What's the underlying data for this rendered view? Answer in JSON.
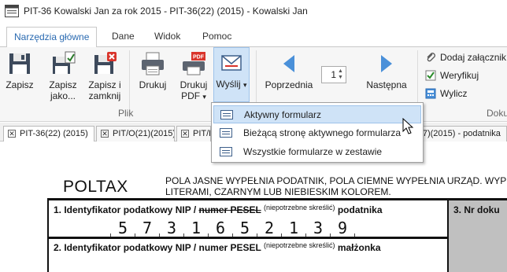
{
  "window": {
    "title": "PIT-36 Kowalski Jan za rok 2015 - PIT-36(22) (2015) - Kowalski Jan"
  },
  "ribbon_tabs": [
    "Narzędzia główne",
    "Dane",
    "Widok",
    "Pomoc"
  ],
  "toolbar": {
    "zapisz": "Zapisz",
    "zapisz_jako_1": "Zapisz",
    "zapisz_jako_2": "jako...",
    "zapisz_zamknij_1": "Zapisz i",
    "zapisz_zamknij_2": "zamknij",
    "drukuj": "Drukuj",
    "drukuj_pdf_1": "Drukuj",
    "drukuj_pdf_2": "PDF",
    "wyslij": "Wyślij",
    "poprzednia": "Poprzednia",
    "nastepna": "Następna",
    "page_value": "1",
    "dodaj_zalacznik": "Dodaj załącznik",
    "weryfikuj": "Weryfikuj",
    "wylicz": "Wylicz",
    "group_plik": "Plik",
    "group_doku": "Doku",
    "pdf_badge": "PDF",
    "dropdown_arrow": "▾"
  },
  "send_menu": {
    "items": [
      "Aktywny formularz",
      "Bieżącą stronę aktywnego formularza",
      "Wszystkie formularze w zestawie"
    ]
  },
  "doc_tabs": [
    "PIT-36(22) (2015)",
    "PIT/O(21)(2015)",
    "PIT/D",
    "M(7)(2015) - podatnika"
  ],
  "document": {
    "brand": "POLTAX",
    "note_line1": "POLA JASNE WYPEŁNIA PODATNIK, POLA CIEMNE WYPEŁNIA URZĄD. WYP",
    "note_line2": "LITERAMI, CZARNYM LUB NIEBIESKIM KOLOREM.",
    "field1_prefix": "1. Identyfikator podatkowy NIP / ",
    "field1_strike": "numer PESEL",
    "field1_note": "(niepotrzebne skreślić)",
    "field1_suffix": " podatnika",
    "field3": "3. Nr doku",
    "nip_digits": [
      "5",
      "7",
      "3",
      "1",
      "6",
      "5",
      "2",
      "1",
      "3",
      "9"
    ],
    "field2_prefix": "2. Identyfikator podatkowy NIP / numer PESEL ",
    "field2_note": "(niepotrzebne skreślić)",
    "field2_suffix": " małżonka"
  },
  "colors": {
    "accent": "#2a6ab1",
    "highlight": "#cfe3f7",
    "grey_field": "#c0c0c0"
  }
}
